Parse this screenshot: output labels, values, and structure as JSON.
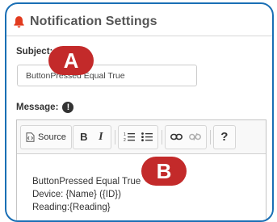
{
  "panel": {
    "title": "Notification Settings",
    "bell_icon": "bell-icon",
    "accent_color": "#1a6fb5",
    "bell_color": "#e23b1f"
  },
  "subject": {
    "label": "Subject:",
    "value": "ButtonPressed Equal True"
  },
  "message": {
    "label": "Message:",
    "alert_glyph": "!",
    "toolbar": {
      "source_label": "Source",
      "bold_label": "B",
      "italic_label": "I",
      "help_label": "?",
      "icons": [
        "source-icon",
        "bold-icon",
        "italic-icon",
        "numbered-list-icon",
        "bulleted-list-icon",
        "link-icon",
        "unlink-icon",
        "help-icon"
      ]
    },
    "body_lines": [
      "ButtonPressed Equal True",
      "Device: {Name} ({ID})",
      "Reading:{Reading}"
    ]
  },
  "callouts": {
    "a": "A",
    "b": "B",
    "color": "#c32a2a"
  }
}
